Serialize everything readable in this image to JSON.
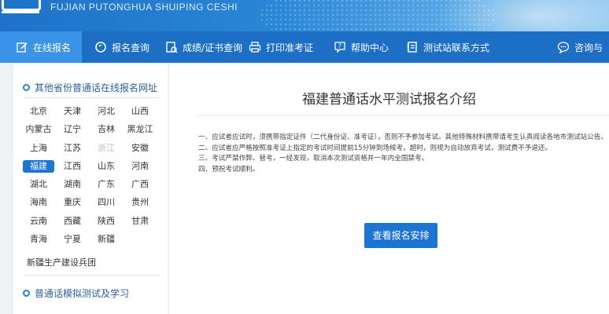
{
  "header": {
    "subtitle": "FUJIAN PUTONGHUA SHUIPING CESHI"
  },
  "nav": {
    "items": [
      {
        "label": "在线报名",
        "icon": "edit-icon"
      },
      {
        "label": "报名查询",
        "icon": "search-icon"
      },
      {
        "label": "成绩/证书查询",
        "icon": "certificate-search-icon"
      },
      {
        "label": "打印准考证",
        "icon": "printer-icon"
      },
      {
        "label": "帮助中心",
        "icon": "help-icon"
      },
      {
        "label": "测试站联系方式",
        "icon": "contact-book-icon"
      },
      {
        "label": "咨询与",
        "icon": "chat-icon"
      }
    ]
  },
  "sidebar": {
    "section1_title": "其他省份普通话在线报名网址",
    "provinces": [
      {
        "name": "北京"
      },
      {
        "name": "天津"
      },
      {
        "name": "河北"
      },
      {
        "name": "山西"
      },
      {
        "name": "内蒙古"
      },
      {
        "name": "辽宁"
      },
      {
        "name": "吉林"
      },
      {
        "name": "黑龙江"
      },
      {
        "name": "上海"
      },
      {
        "name": "江苏"
      },
      {
        "name": "浙江",
        "disabled": true
      },
      {
        "name": "安徽"
      },
      {
        "name": "福建",
        "active": true
      },
      {
        "name": "江西"
      },
      {
        "name": "山东"
      },
      {
        "name": "河南"
      },
      {
        "name": "湖北"
      },
      {
        "name": "湖南"
      },
      {
        "name": "广东"
      },
      {
        "name": "广西"
      },
      {
        "name": "海南"
      },
      {
        "name": "重庆"
      },
      {
        "name": "四川"
      },
      {
        "name": "贵州"
      },
      {
        "name": "云南"
      },
      {
        "name": "西藏"
      },
      {
        "name": "陕西"
      },
      {
        "name": "甘肃"
      },
      {
        "name": "青海"
      },
      {
        "name": "宁夏"
      },
      {
        "name": "新疆"
      }
    ],
    "corps": "新疆生产建设兵团",
    "section2_title": "普通话模拟测试及学习"
  },
  "main": {
    "title": "福建普通话水平测试报名介绍",
    "notices": [
      "一、应试者应试时，须携带指定证件（二代身份证、准考证），否则不予参加考试。其他特殊材料携带请考生认真阅读各地市测试站公告。",
      "二、应试者应严格按照准考证上指定的考试时间提前15分钟到场候考，超时，则视为自动放弃考试，测试费不予退还。",
      "三、考试严禁作弊、替考，一经发现，取消本次测试资格并一年内全国禁考。",
      "四、预祝考试顺利。"
    ],
    "cta_label": "查看报名安排"
  },
  "colors": {
    "nav_bg": "#1c6fc4",
    "nav_active": "#3a93e6",
    "accent": "#1d74d3"
  }
}
